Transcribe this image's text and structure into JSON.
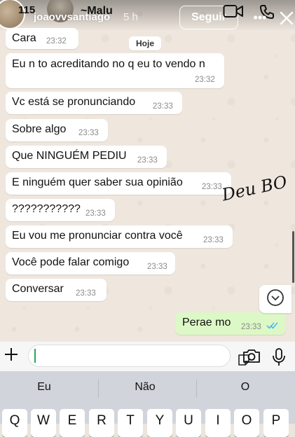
{
  "story": {
    "count": "115",
    "username": "joaovvsantiago",
    "time_ago": "5 h",
    "follow_label": "Seguir",
    "overlay_text": "Deu BO"
  },
  "chat": {
    "contact_name": "~Malu",
    "date_label": "Hoje",
    "messages": [
      {
        "text": "Cara",
        "time": "23:32"
      },
      {
        "text": "Eu n to acreditando no q eu to vendo n",
        "time": "23:32"
      },
      {
        "text": "Vc está se pronunciando",
        "time": "23:33"
      },
      {
        "text": "Sobre algo",
        "time": "23:33"
      },
      {
        "text": "Que NINGUÉM PEDIU",
        "time": "23:33"
      },
      {
        "text": "E ninguém quer saber sua opinião",
        "time": "23:33"
      },
      {
        "text": "???????????",
        "time": "23:33"
      },
      {
        "text": "Eu vou me pronunciar contra você",
        "time": "23:33"
      },
      {
        "text": "Você pode falar comigo",
        "time": "23:33"
      },
      {
        "text": "Conversar",
        "time": "23:33"
      }
    ],
    "outgoing": {
      "text": "Perae mo",
      "time": "23:33",
      "status": "read"
    }
  },
  "keyboard": {
    "suggestions": [
      "Eu",
      "Não",
      "O"
    ],
    "row1": [
      "Q",
      "W",
      "E",
      "R",
      "T",
      "Y",
      "U",
      "I",
      "O",
      "P"
    ]
  },
  "colors": {
    "outgoing_bubble": "#dcf8c6",
    "read_ticks": "#4fb6ec",
    "caret": "#26a65b"
  }
}
